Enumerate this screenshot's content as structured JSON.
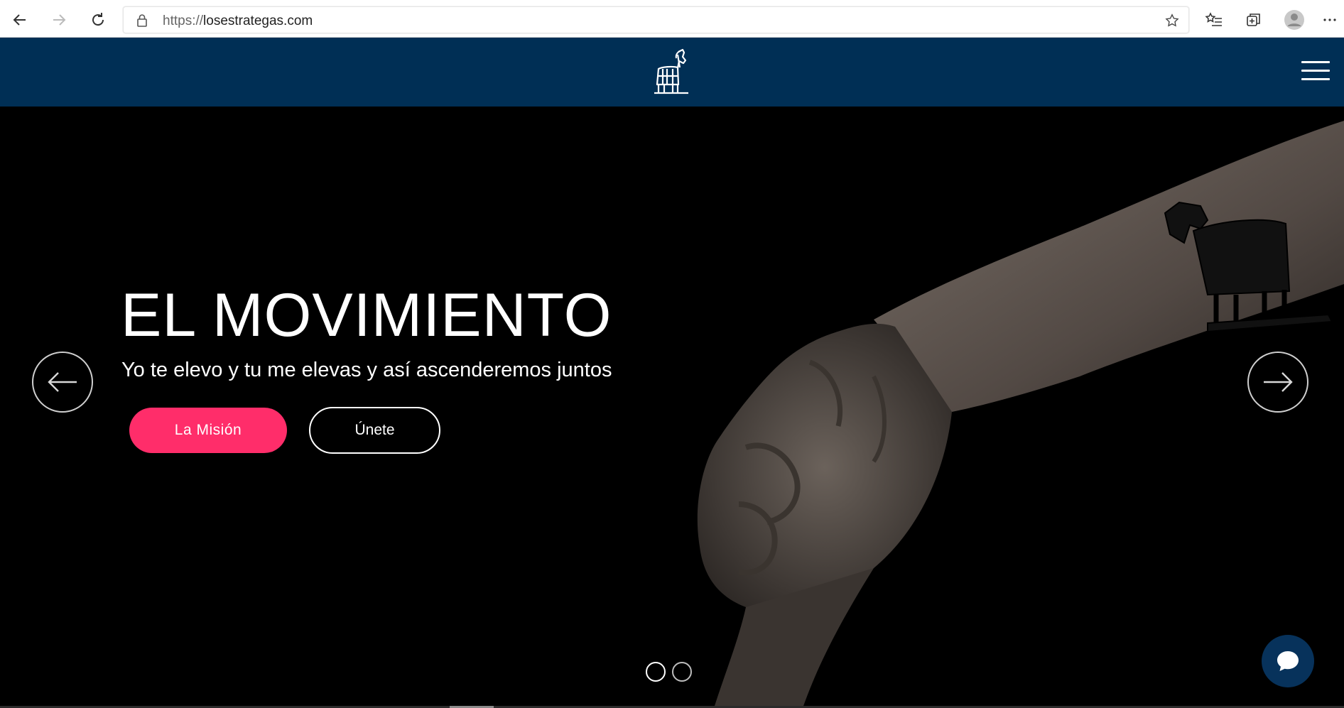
{
  "browser": {
    "url_scheme": "https://",
    "url_host": "losestrategas.com",
    "icons": [
      "back-icon",
      "forward-icon",
      "refresh-icon",
      "lock-icon",
      "star-icon",
      "favorites-icon",
      "collections-icon",
      "profile-icon",
      "more-icon"
    ]
  },
  "site": {
    "logo_icon": "trojan-horse-logo-icon",
    "menu_icon": "hamburger-menu-icon",
    "brand_color": "#002f55"
  },
  "hero": {
    "title": "EL MOVIMIENTO",
    "subtitle": "Yo te elevo y tu me elevas y así ascenderemos juntos",
    "primary_button": "La Misión",
    "secondary_button": "Únete",
    "accent_color": "#ff2d6a",
    "slides_total": 2,
    "active_slide": 1
  },
  "chat": {
    "icon": "chat-bubble-icon"
  }
}
